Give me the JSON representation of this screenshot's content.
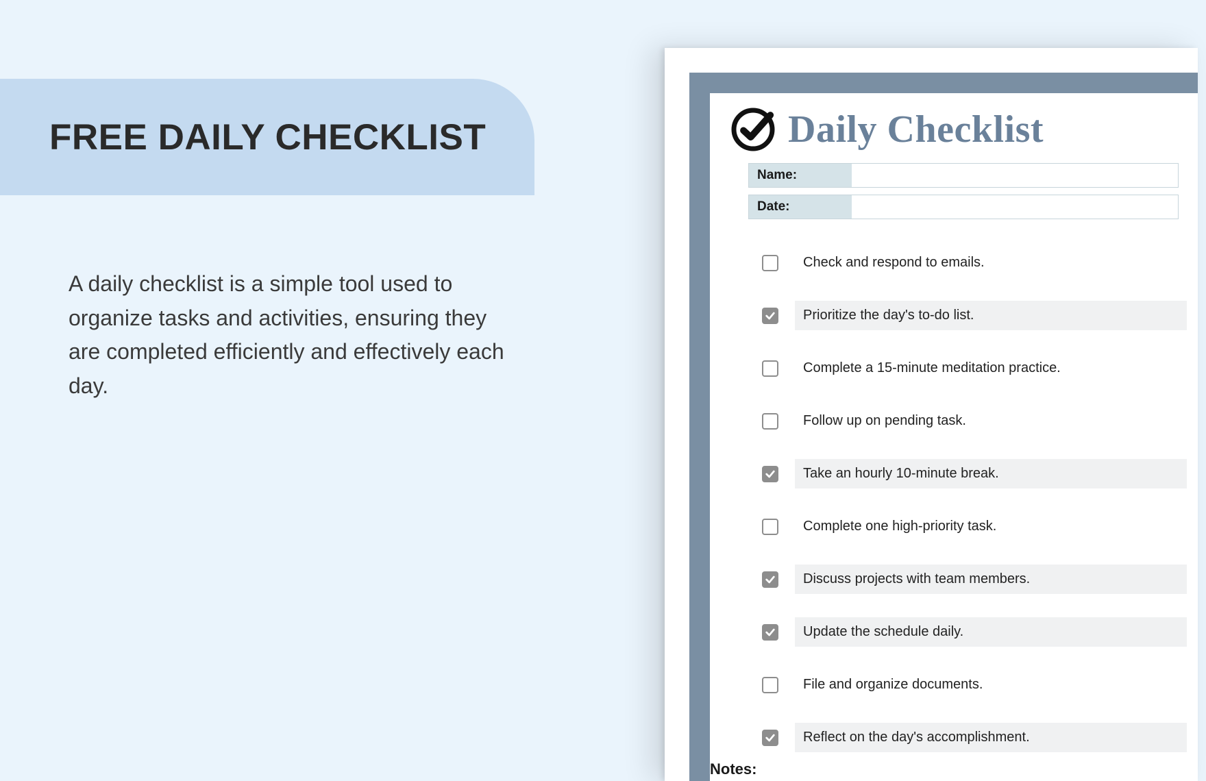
{
  "left": {
    "banner_title": "FREE DAILY CHECKLIST",
    "description": "A daily checklist is a simple tool used to organize tasks and activities, ensuring they are completed efficiently and effectively each day."
  },
  "doc": {
    "title": "Daily Checklist",
    "fields": {
      "name_label": "Name:",
      "name_value": "",
      "date_label": "Date:",
      "date_value": ""
    },
    "items": [
      {
        "text": "Check and respond to emails.",
        "checked": false,
        "shaded": false
      },
      {
        "text": "Prioritize the day's to-do list.",
        "checked": true,
        "shaded": true
      },
      {
        "text": "Complete a 15-minute meditation practice.",
        "checked": false,
        "shaded": false
      },
      {
        "text": "Follow up on pending task.",
        "checked": false,
        "shaded": false
      },
      {
        "text": "Take an hourly 10-minute break.",
        "checked": true,
        "shaded": true
      },
      {
        "text": "Complete one high-priority task.",
        "checked": false,
        "shaded": false
      },
      {
        "text": "Discuss projects with team members.",
        "checked": true,
        "shaded": true
      },
      {
        "text": "Update the schedule daily.",
        "checked": true,
        "shaded": true
      },
      {
        "text": "File and organize documents.",
        "checked": false,
        "shaded": false
      },
      {
        "text": "Reflect on the day's accomplishment.",
        "checked": true,
        "shaded": true
      }
    ],
    "notes_label": "Notes:"
  }
}
